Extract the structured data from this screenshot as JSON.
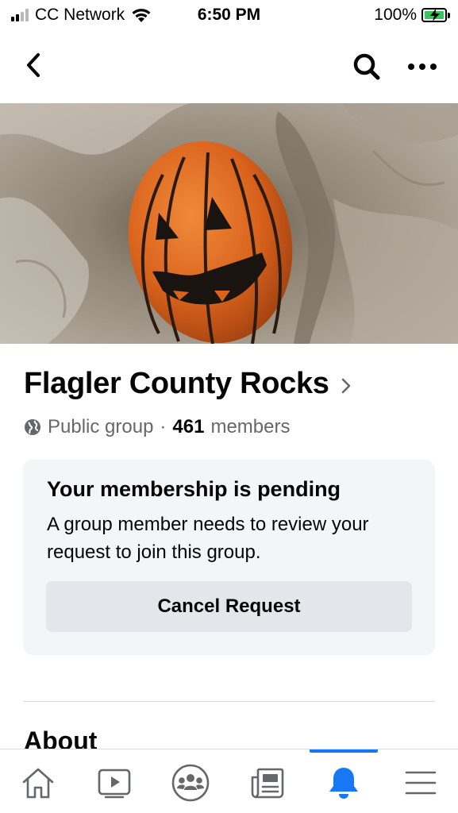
{
  "status_bar": {
    "carrier": "CC Network",
    "time": "6:50 PM",
    "battery": "100%",
    "battery_level": 1.0,
    "battery_color": "#34c759"
  },
  "nav": {
    "back_icon": "chevron-left-icon",
    "search_icon": "search-icon",
    "more_icon": "more-horizontal-icon"
  },
  "group": {
    "name": "Flagler County Rocks",
    "privacy": "Public group",
    "separator": "·",
    "member_count": "461",
    "member_label": "members"
  },
  "membership": {
    "title": "Your membership is pending",
    "body": "A group member needs to review your request to join this group.",
    "cancel_label": "Cancel Request"
  },
  "about": {
    "heading": "About"
  },
  "tab_bar": {
    "accent": "#1877f2",
    "tabs": [
      {
        "icon": "home-icon",
        "active": false
      },
      {
        "icon": "video-icon",
        "active": false
      },
      {
        "icon": "groups-icon",
        "active": false
      },
      {
        "icon": "news-icon",
        "active": false
      },
      {
        "icon": "bell-icon",
        "active": true
      },
      {
        "icon": "menu-icon",
        "active": false
      }
    ]
  }
}
